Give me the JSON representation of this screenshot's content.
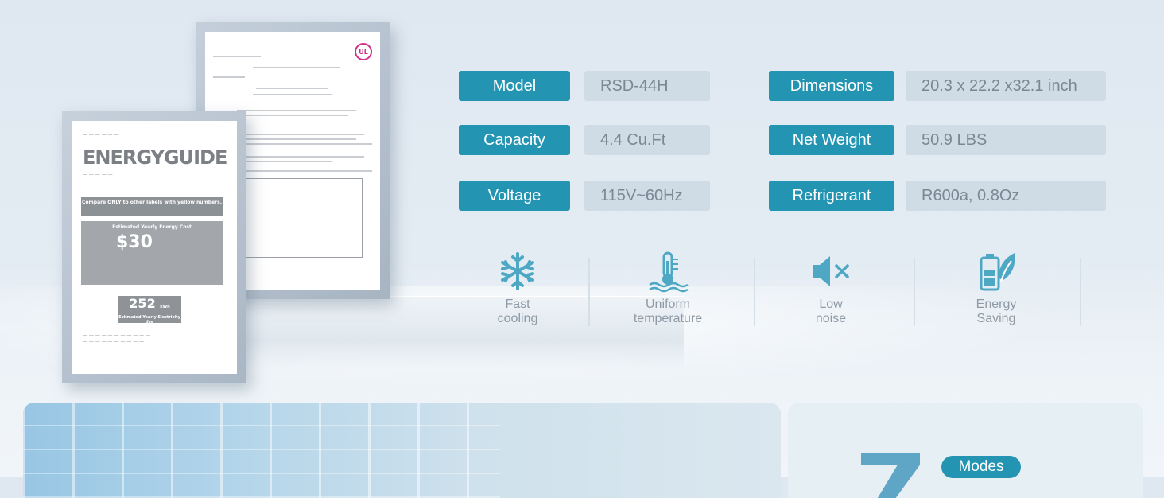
{
  "specs": [
    {
      "label": "Model",
      "value": "RSD-44H"
    },
    {
      "label": "Dimensions",
      "value": "20.3 x 22.2 x32.1 inch"
    },
    {
      "label": "Capacity",
      "value": "4.4 Cu.Ft"
    },
    {
      "label": "Net Weight",
      "value": "50.9 LBS"
    },
    {
      "label": "Voltage",
      "value": "115V~60Hz"
    },
    {
      "label": "Refrigerant",
      "value": "R600a, 0.8Oz"
    }
  ],
  "features": [
    {
      "icon": "snowflake-icon",
      "line1": "Fast",
      "line2": "cooling"
    },
    {
      "icon": "thermometer-icon",
      "line1": "Uniform",
      "line2": "temperature"
    },
    {
      "icon": "speaker-mute-icon",
      "line1": "Low",
      "line2": "noise"
    },
    {
      "icon": "battery-leaf-icon",
      "line1": "Energy",
      "line2": "Saving"
    }
  ],
  "energy_guide": {
    "title": "ENERGYGUIDE",
    "compare_text": "Compare ONLY to other labels with yellow numbers.",
    "cost_label": "Estimated Yearly Energy Cost",
    "cost_value": "$30",
    "kwh_value": "252",
    "kwh_unit": "kWh",
    "kwh_label": "Estimated Yearly Electricity Use"
  },
  "certificate": {
    "logo_text": "UL"
  },
  "modes_badge": "Modes",
  "colors": {
    "accent": "#2494b3",
    "value_bg": "#cfdbe5",
    "value_text": "#7b8793",
    "icon": "#4fa8c3"
  }
}
